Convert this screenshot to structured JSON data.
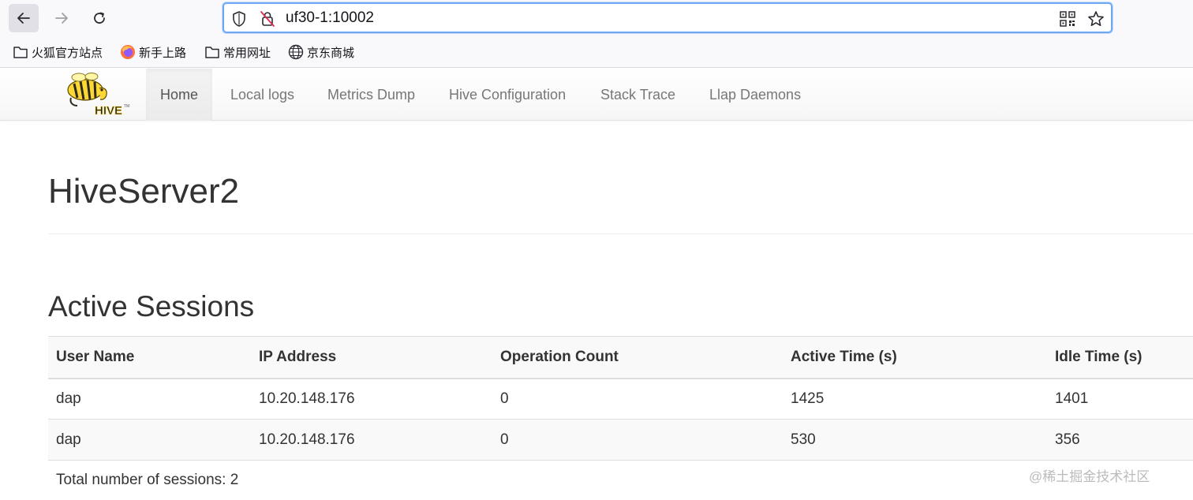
{
  "browser": {
    "url": "uf30-1:10002",
    "bookmarks": [
      {
        "label": "火狐官方站点",
        "icon": "folder-icon"
      },
      {
        "label": "新手上路",
        "icon": "firefox-icon"
      },
      {
        "label": "常用网址",
        "icon": "folder-icon"
      },
      {
        "label": "京东商城",
        "icon": "globe-icon"
      }
    ]
  },
  "navbar": {
    "items": [
      {
        "label": "Home",
        "active": true
      },
      {
        "label": "Local logs"
      },
      {
        "label": "Metrics Dump"
      },
      {
        "label": "Hive Configuration"
      },
      {
        "label": "Stack Trace"
      },
      {
        "label": "Llap Daemons"
      }
    ]
  },
  "page": {
    "title": "HiveServer2",
    "section_title": "Active Sessions"
  },
  "sessions": {
    "columns": [
      "User Name",
      "IP Address",
      "Operation Count",
      "Active Time (s)",
      "Idle Time (s)"
    ],
    "rows": [
      [
        "dap",
        "10.20.148.176",
        "0",
        "1425",
        "1401"
      ],
      [
        "dap",
        "10.20.148.176",
        "0",
        "530",
        "356"
      ]
    ],
    "total": "Total number of sessions: 2"
  },
  "watermark": "@稀土掘金技术社区",
  "colors": {
    "accent_focus": "#6ea8f2",
    "text": "#333333",
    "nav_text": "#777777"
  }
}
